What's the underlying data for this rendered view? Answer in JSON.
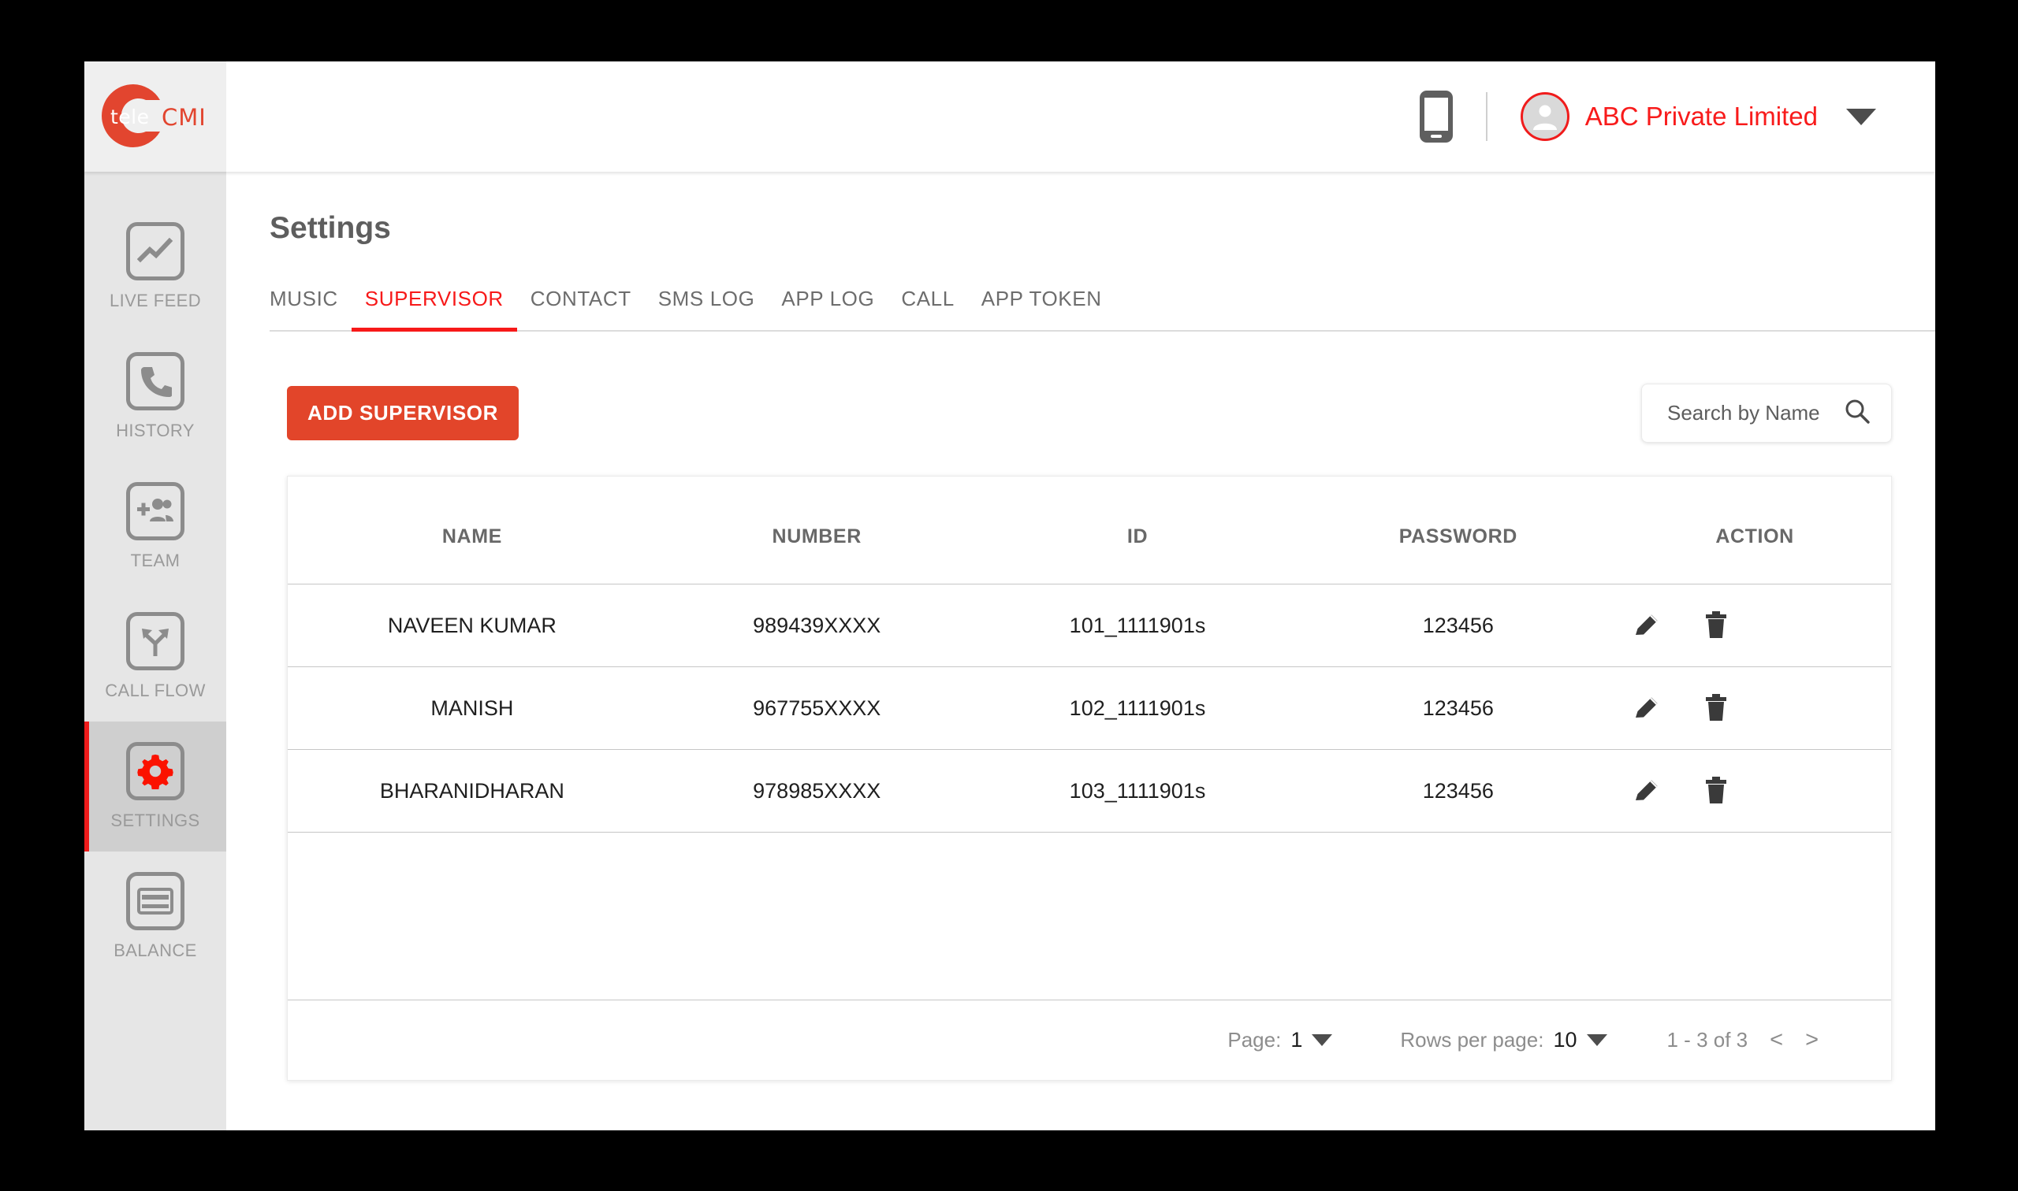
{
  "brand": {
    "logo_text_left": "tele",
    "logo_text_right": "CMI",
    "accent_red": "#e2452a",
    "link_red": "#f71919"
  },
  "topbar": {
    "mobile_icon": "mobile-phone-icon",
    "account_name": "ABC Private Limited",
    "account_caret": "chevron-down-icon"
  },
  "sidebar": {
    "items": [
      {
        "label": "LIVE FEED",
        "icon": "line-chart-icon",
        "active": false
      },
      {
        "label": "HISTORY",
        "icon": "phone-icon",
        "active": false
      },
      {
        "label": "TEAM",
        "icon": "add-people-icon",
        "active": false
      },
      {
        "label": "CALL FLOW",
        "icon": "call-flow-arrows-icon",
        "active": false
      },
      {
        "label": "SETTINGS",
        "icon": "gear-icon",
        "active": true
      },
      {
        "label": "BALANCE",
        "icon": "card-icon",
        "active": false
      }
    ]
  },
  "main": {
    "page_title": "Settings",
    "tabs": [
      {
        "label": "MUSIC",
        "active": false
      },
      {
        "label": "SUPERVISOR",
        "active": true
      },
      {
        "label": "CONTACT",
        "active": false
      },
      {
        "label": "SMS LOG",
        "active": false
      },
      {
        "label": "APP LOG",
        "active": false
      },
      {
        "label": "CALL",
        "active": false
      },
      {
        "label": "APP TOKEN",
        "active": false
      }
    ],
    "toolbar": {
      "add_button_label": "ADD SUPERVISOR",
      "search_placeholder": "Search by Name",
      "search_value": "",
      "search_icon": "search-icon"
    },
    "table": {
      "headers": [
        "NAME",
        "NUMBER",
        "ID",
        "PASSWORD",
        "ACTION"
      ],
      "rows": [
        {
          "name": "NAVEEN KUMAR",
          "number": "989439XXXX",
          "id": "101_1111901s",
          "password": "123456",
          "edit_icon": "edit-pencil-icon",
          "delete_icon": "trash-icon"
        },
        {
          "name": "MANISH",
          "number": "967755XXXX",
          "id": "102_1111901s",
          "password": "123456",
          "edit_icon": "edit-pencil-icon",
          "delete_icon": "trash-icon"
        },
        {
          "name": "BHARANIDHARAN",
          "number": "978985XXXX",
          "id": "103_1111901s",
          "password": "123456",
          "edit_icon": "edit-pencil-icon",
          "delete_icon": "trash-icon"
        }
      ]
    },
    "footer": {
      "page_label": "Page:",
      "page_value": "1",
      "rows_per_page_label": "Rows per page:",
      "rows_per_page_value": "10",
      "range_text": "1 - 3 of 3",
      "prev_label": "<",
      "next_label": ">"
    }
  }
}
